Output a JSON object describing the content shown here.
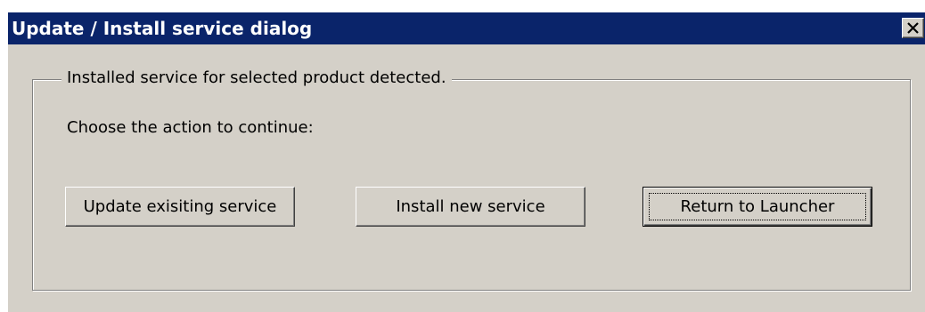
{
  "window": {
    "title": "Update / Install service dialog",
    "close_icon": "close-icon",
    "title_bar_color": "#0a246a",
    "background_color": "#d4d0c8"
  },
  "group": {
    "legend": "Installed service for selected product detected.",
    "prompt": "Choose the action to continue:"
  },
  "buttons": {
    "update_label": "Update exisiting service",
    "install_label": "Install new service",
    "return_label": "Return to Launcher",
    "focused": "return"
  }
}
